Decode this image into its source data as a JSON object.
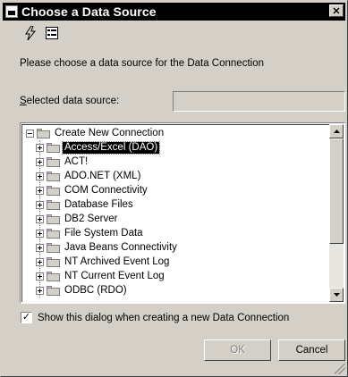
{
  "window": {
    "title": "Choose a Data Source",
    "close_glyph": "✕"
  },
  "toolbar": {
    "buttons": [
      {
        "icon": "lightning-icon"
      },
      {
        "icon": "properties-icon"
      }
    ]
  },
  "instruction": "Please choose a data source for the Data Connection",
  "selected_source": {
    "label_prefix": "",
    "label_mnemonic": "S",
    "label_rest": "elected data source:",
    "value": ""
  },
  "tree": {
    "root": {
      "label": "Create New Connection",
      "expanded": true
    },
    "items": [
      {
        "label": "Access/Excel (DAO)",
        "selected": true
      },
      {
        "label": "ACT!",
        "selected": false
      },
      {
        "label": "ADO.NET (XML)",
        "selected": false
      },
      {
        "label": "COM Connectivity",
        "selected": false
      },
      {
        "label": "Database Files",
        "selected": false
      },
      {
        "label": "DB2 Server",
        "selected": false
      },
      {
        "label": "File System Data",
        "selected": false
      },
      {
        "label": "Java Beans Connectivity",
        "selected": false
      },
      {
        "label": "NT Archived Event Log",
        "selected": false
      },
      {
        "label": "NT Current Event Log",
        "selected": false
      },
      {
        "label": "ODBC (RDO)",
        "selected": false
      }
    ]
  },
  "show_dialog": {
    "checked": true,
    "check_glyph": "✓",
    "label": "Show this dialog when creating a new Data Connection"
  },
  "buttons": {
    "ok": "OK",
    "cancel": "Cancel"
  }
}
